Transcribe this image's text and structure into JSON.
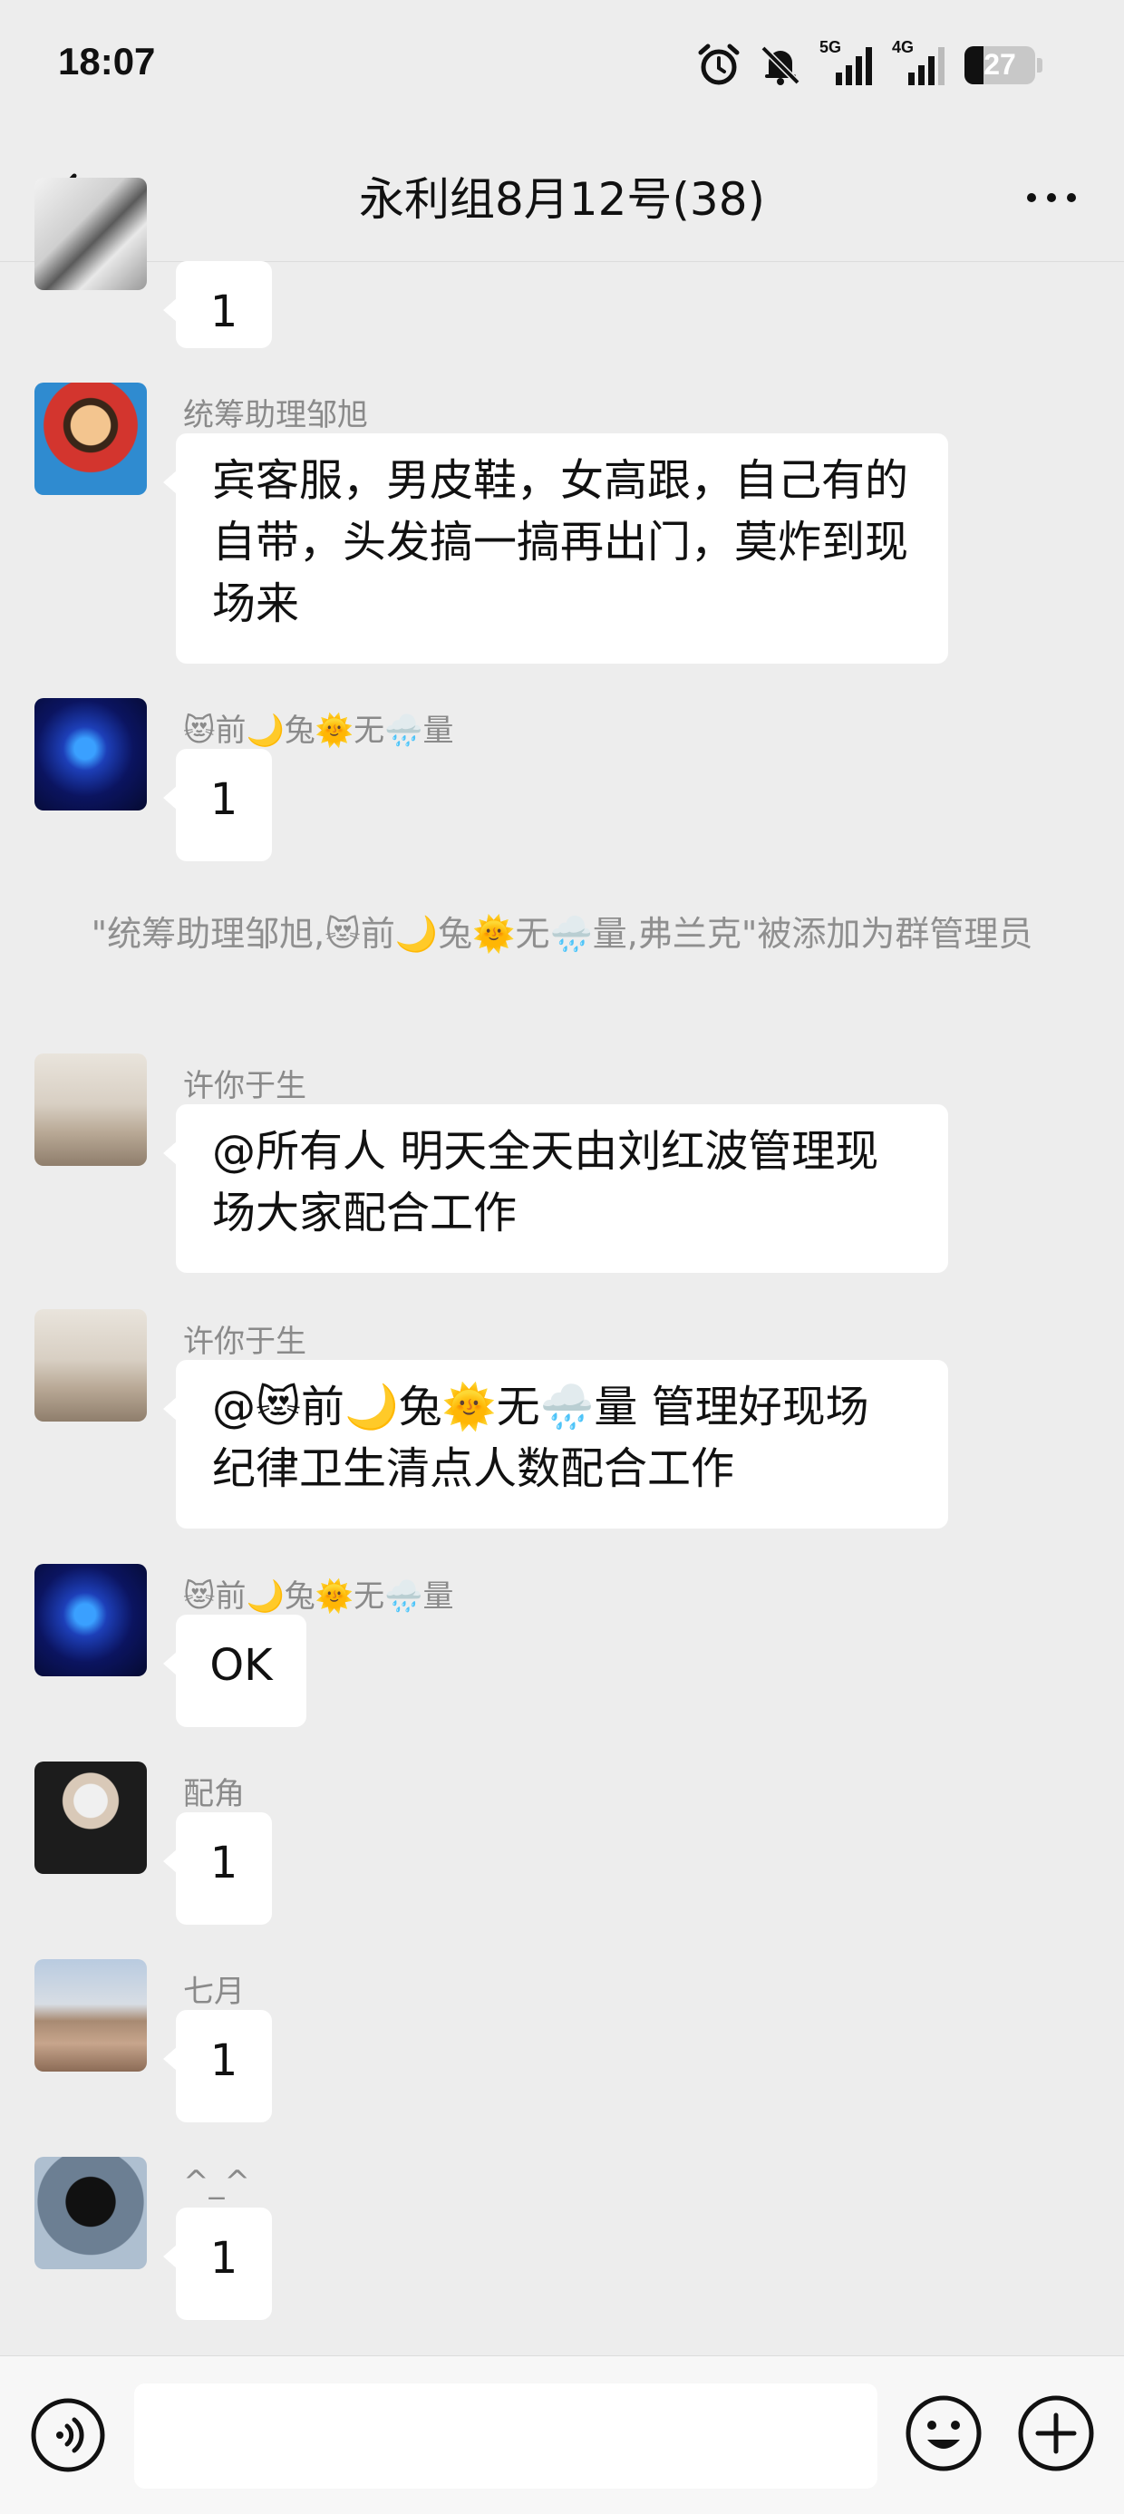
{
  "status_bar": {
    "time": "18:07",
    "net1": "5G",
    "net2": "4G",
    "battery": "27",
    "battery_level": 27
  },
  "header": {
    "title": "永利组8月12号(38)"
  },
  "messages": [
    {
      "sender": "",
      "text": "1"
    },
    {
      "sender": "统筹助理邹旭",
      "text": "宾客服，男皮鞋，女高跟，自己有的自带，头发搞一搞再出门，莫炸到现场来"
    },
    {
      "sender": "😻前🌙兔🌞无🌧️量",
      "text": "1"
    },
    {
      "sender": "许你于生",
      "text": "@所有人  明天全天由刘红波管理现场大家配合工作"
    },
    {
      "sender": "许你于生",
      "text": "@😻前🌙兔🌞无🌧️量  管理好现场纪律卫生清点人数配合工作"
    },
    {
      "sender": "😻前🌙兔🌞无🌧️量",
      "text": "OK"
    },
    {
      "sender": "配角",
      "text": "1"
    },
    {
      "sender": "七月",
      "text": "1"
    },
    {
      "sender": "^_^",
      "text": "1"
    }
  ],
  "system_notice": "\"统筹助理邹旭,😻前🌙兔🌞无🌧️量,弗兰克\"被添加为群管理员",
  "icons": {
    "back": "back-arrow-icon",
    "more": "more-dots-icon",
    "voice": "voice-icon",
    "emoji": "emoji-icon",
    "plus": "plus-icon"
  }
}
